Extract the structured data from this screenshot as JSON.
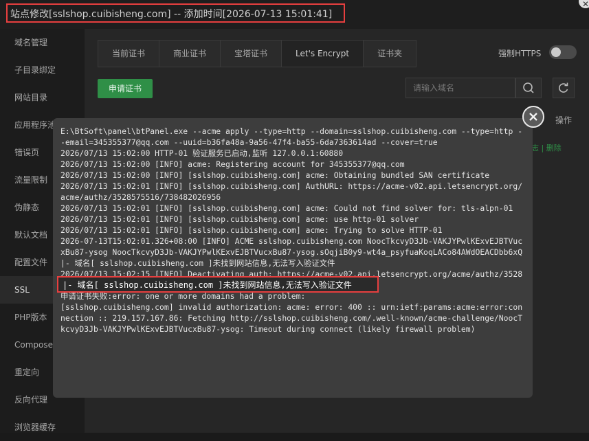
{
  "window": {
    "title": "站点修改[sslshop.cuibisheng.com] -- 添加时间[2026-07-13 15:01:41]"
  },
  "sidebar": {
    "items": [
      {
        "label": "域名管理"
      },
      {
        "label": "子目录绑定"
      },
      {
        "label": "网站目录"
      },
      {
        "label": "应用程序池"
      },
      {
        "label": "错误页"
      },
      {
        "label": "流量限制"
      },
      {
        "label": "伪静态"
      },
      {
        "label": "默认文档"
      },
      {
        "label": "配置文件"
      },
      {
        "label": "SSL"
      },
      {
        "label": "PHP版本"
      },
      {
        "label": "Composer"
      },
      {
        "label": "重定向"
      },
      {
        "label": "反向代理"
      },
      {
        "label": "浏览器缓存"
      }
    ],
    "active_index": 9
  },
  "tabs": [
    {
      "label": "当前证书"
    },
    {
      "label": "商业证书"
    },
    {
      "label": "宝塔证书"
    },
    {
      "label": "Let's Encrypt"
    },
    {
      "label": "证书夹"
    }
  ],
  "active_tab": 3,
  "force_https": {
    "label": "强制HTTPS",
    "enabled": false
  },
  "toolbar": {
    "apply_label": "申请证书",
    "search_placeholder": "请输入域名"
  },
  "table": {
    "ops_header": "操作",
    "ops_links": "志 | 删除"
  },
  "log": {
    "before": "E:\\BtSoft\\panel\\btPanel.exe --acme apply --type=http --domain=sslshop.cuibisheng.com --type=http --email=345355377@qq.com --uuid=b36fa48a-9a56-47f4-ba55-6da7363614ad --cover=true\n2026/07/13 15:02:00 HTTP-01 验证服务已启动,监听 127.0.0.1:60880\n2026/07/13 15:02:00 [INFO] acme: Registering account for 345355377@qq.com\n2026/07/13 15:02:00 [INFO] [sslshop.cuibisheng.com] acme: Obtaining bundled SAN certificate\n2026/07/13 15:02:01 [INFO] [sslshop.cuibisheng.com] AuthURL: https://acme-v02.api.letsencrypt.org/acme/authz/3528575516/738482026956\n2026/07/13 15:02:01 [INFO] [sslshop.cuibisheng.com] acme: Could not find solver for: tls-alpn-01\n2026/07/13 15:02:01 [INFO] [sslshop.cuibisheng.com] acme: use http-01 solver\n2026/07/13 15:02:01 [INFO] [sslshop.cuibisheng.com] acme: Trying to solve HTTP-01\n2026-07-13T15:02:01.326+08:00 [INFO] ACME sslshop.cuibisheng.com NoocTkcvyD3Jb-VAKJYPwlKExvEJBTVucxBu87-ysog NoocTkcvyD3Jb-VAKJYPwlKExvEJBTVucxBu87-ysog.sOqjiB0y9-wt4a_psyfuaKoqLACo84AWdOEACDbb6xQ\n|- 域名[ sslshop.cuibisheng.com ]未找到网站信息,无法写入验证文件\n2026/07/13 15:02:15 [INFO] Deactivating auth: https://acme-v02.api.letsencrypt.org/acme/authz/3528575516/738482026956\n申请证书失败:error: one or more domains had a problem:\n[sslshop.cuibisheng.com] invalid authorization: acme: error: 400 :: urn:ietf:params:acme:error:connection :: 219.157.167.86: Fetching http://sslshop.cuibisheng.com/.well-known/acme-challenge/NoocTkcvyD3Jb-VAKJYPwlKExvEJBTVucxBu87-ysog: Timeout during connect (likely firewall problem)",
    "highlight": "|- 域名[ sslshop.cuibisheng.com ]未找到网站信息,无法写入验证文件"
  }
}
